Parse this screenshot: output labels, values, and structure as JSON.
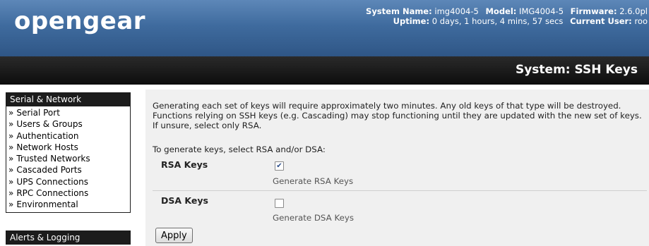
{
  "header": {
    "logo": "opengear",
    "line1": [
      {
        "label": "System Name:",
        "value": "img4004-5"
      },
      {
        "label": "Model:",
        "value": "IMG4004-5"
      },
      {
        "label": "Firmware:",
        "value": "2.6.0pl"
      }
    ],
    "line2": [
      {
        "label": "Uptime:",
        "value": "0 days, 1 hours, 4 mins, 57 secs"
      },
      {
        "label": "Current User:",
        "value": "roo"
      }
    ]
  },
  "page_title": "System: SSH Keys",
  "sidebar": {
    "serial_network": {
      "heading": "Serial & Network",
      "items": [
        "Serial Port",
        "Users & Groups",
        "Authentication",
        "Network Hosts",
        "Trusted Networks",
        "Cascaded Ports",
        "UPS Connections",
        "RPC Connections",
        "Environmental"
      ]
    },
    "alerts_logging": {
      "heading": "Alerts & Logging"
    }
  },
  "main": {
    "intro_line1": "Generating each set of keys will require approximately two minutes. Any old keys of that type will be destroyed.",
    "intro_line2": "Functions relying on SSH keys (e.g. Cascading) may stop functioning until they are updated with the new set of keys.",
    "intro_line3": "If unsure, select only RSA.",
    "instruction": "To generate keys, select RSA and/or DSA:",
    "rsa": {
      "label": "RSA Keys",
      "checked": true,
      "description": "Generate RSA Keys"
    },
    "dsa": {
      "label": "DSA Keys",
      "checked": false,
      "description": "Generate DSA Keys"
    },
    "apply_label": "Apply"
  },
  "colors": {
    "header_blue": "#3f6b9e",
    "titlebar_black": "#111111",
    "content_gray": "#f0f0f0"
  }
}
